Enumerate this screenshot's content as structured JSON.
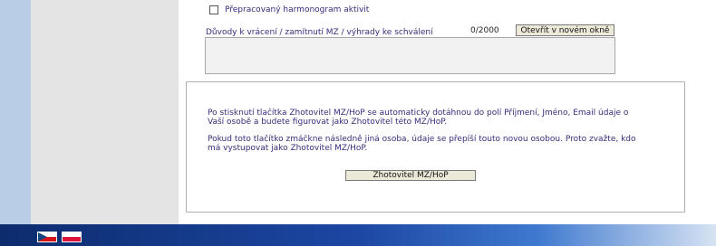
{
  "checkbox": {
    "label": "Přepracovaný harmonogram aktivit",
    "checked": false
  },
  "reasons": {
    "label": "Důvody k vrácení / zamítnutí MZ / výhrady ke schválení",
    "counter": "0/2000",
    "open_button": "Otevřít v novém okně",
    "value": ""
  },
  "info": {
    "paragraph1": "Po stisknutí tlačítka Zhotovitel MZ/HoP se automaticky dotáhnou do polí Příjmení, Jméno, Email údaje o Vaší osobě a budete figurovat jako Zhotovitel této MZ/HoP.",
    "paragraph2": "Pokud toto tlačítko zmáčkne následně jiná osoba, údaje se přepíší touto novou osobou. Proto zvažte, kdo má vystupovat jako Zhotovitel MZ/HoP.",
    "button": "Zhotovitel MZ/HoP"
  },
  "footer": {
    "flags": [
      "czech-flag",
      "polish-flag"
    ]
  },
  "colors": {
    "text": "#3b2a7a",
    "footer_dark": "#0d2c6e",
    "footer_light": "#d6e3f3",
    "left_strip": "#b9cde6",
    "grey_column": "#e4e4e4"
  }
}
